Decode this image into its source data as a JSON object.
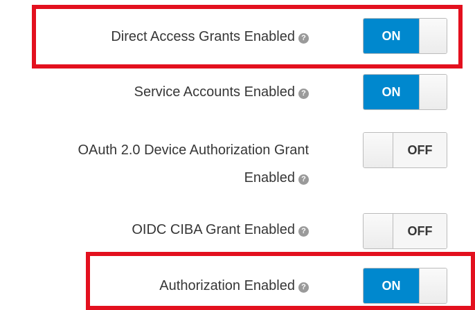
{
  "settings": [
    {
      "label": "Direct Access Grants Enabled",
      "state": "ON"
    },
    {
      "label": "Service Accounts Enabled",
      "state": "ON"
    },
    {
      "label_line1": "OAuth 2.0 Device Authorization Grant",
      "label_line2": "Enabled",
      "state": "OFF"
    },
    {
      "label": "OIDC CIBA Grant Enabled",
      "state": "OFF"
    },
    {
      "label": "Authorization Enabled",
      "state": "ON"
    }
  ],
  "help_glyph": "?",
  "icons": {
    "help": "question-circle-icon"
  },
  "colors": {
    "on_background": "#0088ce",
    "highlight_border": "#e3101e",
    "label_text": "#363636"
  }
}
